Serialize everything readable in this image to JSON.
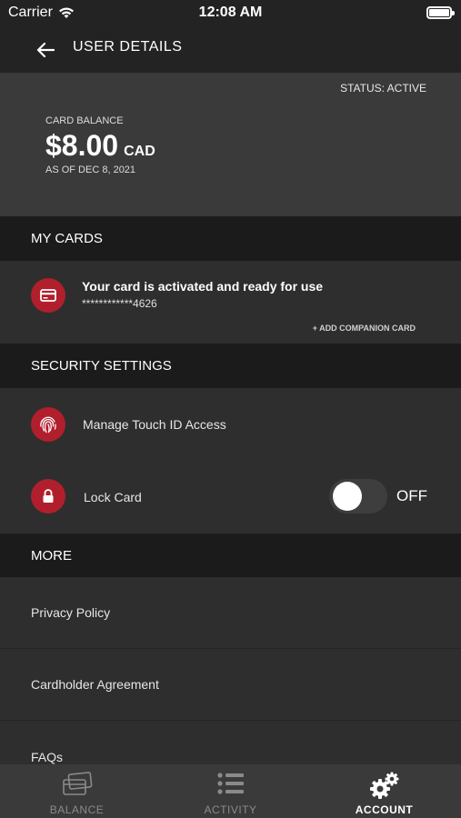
{
  "statusbar": {
    "carrier": "Carrier",
    "time": "12:08 AM",
    "icons": [
      "wifi-icon",
      "battery-icon"
    ]
  },
  "header": {
    "title": "USER DETAILS",
    "back_icon": "arrow-left-icon"
  },
  "balance": {
    "status": "STATUS: ACTIVE",
    "label": "CARD BALANCE",
    "amount": "$8.00",
    "currency": "CAD",
    "as_of": "AS OF DEC 8, 2021"
  },
  "my_cards": {
    "header": "MY CARDS",
    "card_title": "Your card is activated and ready for use",
    "card_number": "************4626",
    "add_companion": "+ ADD COMPANION CARD",
    "icon": "credit-card-icon"
  },
  "security": {
    "header": "SECURITY SETTINGS",
    "touch_id_label": "Manage Touch ID Access",
    "touch_id_icon": "fingerprint-icon",
    "lock_label": "Lock Card",
    "lock_icon": "lock-icon",
    "lock_state": "OFF",
    "lock_enabled": false
  },
  "more": {
    "header": "MORE",
    "links": [
      "Privacy Policy",
      "Cardholder Agreement",
      "FAQs"
    ]
  },
  "tabs": [
    {
      "label": "BALANCE",
      "icon": "cards-icon",
      "active": false
    },
    {
      "label": "ACTIVITY",
      "icon": "list-icon",
      "active": false
    },
    {
      "label": "ACCOUNT",
      "icon": "gears-icon",
      "active": true
    }
  ],
  "colors": {
    "accent": "#b11f2c",
    "background": "#232323",
    "panel": "#3a3a3a",
    "row": "#2e2e2e",
    "section": "#1b1b1b"
  }
}
